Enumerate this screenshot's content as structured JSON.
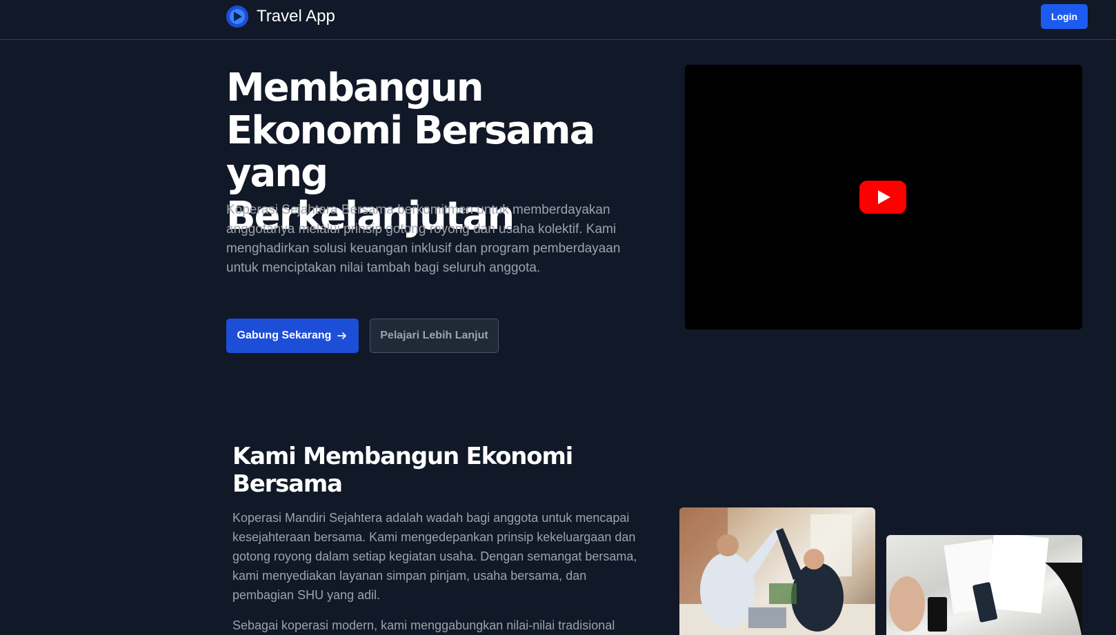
{
  "navbar": {
    "brand_name": "Travel App",
    "login_label": "Login"
  },
  "hero": {
    "title": "Membangun Ekonomi Bersama yang Berkelanjutan",
    "description": "Koperasi Sejahtera Bersama berkomitmen untuk memberdayakan anggotanya melalui prinsip gotong royong dan usaha kolektif. Kami menghadirkan solusi keuangan inklusif dan program pemberdayaan untuk menciptakan nilai tambah bagi seluruh anggota.",
    "primary_button": "Gabung Sekarang",
    "secondary_button": "Pelajari Lebih Lanjut"
  },
  "about": {
    "title": "Kami Membangun Ekonomi Bersama",
    "paragraph1": "Koperasi Mandiri Sejahtera adalah wadah bagi anggota untuk mencapai kesejahteraan bersama. Kami mengedepankan prinsip kekeluargaan dan gotong royong dalam setiap kegiatan usaha. Dengan semangat bersama, kami menyediakan layanan simpan pinjam, usaha bersama, dan pembagian SHU yang adil.",
    "paragraph2": "Sebagai koperasi modern, kami menggabungkan nilai-nilai tradisional"
  },
  "colors": {
    "background": "#111827",
    "accent": "#1d4ed8",
    "text_muted": "#9ca3af",
    "youtube_red": "#ff0000"
  },
  "icons": {
    "brand": "brand-logo-icon",
    "arrow": "arrow-right-icon",
    "video": "youtube-play-icon"
  }
}
